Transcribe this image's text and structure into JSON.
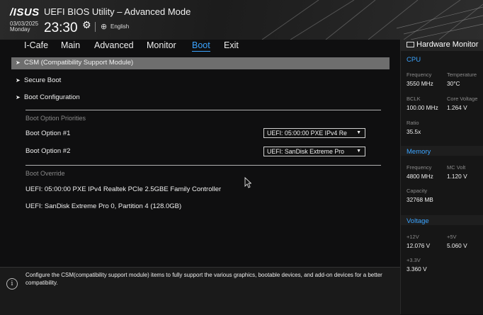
{
  "header": {
    "logo": "/ISUS",
    "title": "UEFI BIOS Utility – Advanced Mode",
    "date": "03/03/2025",
    "day": "Monday",
    "time": "23:30",
    "language": "English"
  },
  "nav": {
    "tabs": [
      {
        "label": "I-Cafe"
      },
      {
        "label": "Main"
      },
      {
        "label": "Advanced"
      },
      {
        "label": "Monitor"
      },
      {
        "label": "Boot"
      },
      {
        "label": "Exit"
      }
    ],
    "active": "Boot"
  },
  "menu": {
    "csm": "CSM (Compatibility Support Module)",
    "secure_boot": "Secure Boot",
    "boot_config": "Boot Configuration",
    "priorities_label": "Boot Option Priorities",
    "option1_label": "Boot Option #1",
    "option1_value": "UEFI: 05:00:00 PXE IPv4 Re",
    "option2_label": "Boot Option #2",
    "option2_value": "UEFI: SanDisk Extreme Pro",
    "override_label": "Boot Override",
    "override1": "UEFI: 05:00:00 PXE IPv4 Realtek PCIe 2.5GBE Family Controller",
    "override2": "UEFI: SanDisk Extreme Pro 0, Partition 4 (128.0GB)"
  },
  "help": {
    "text": "Configure the CSM(compatibility support module) items to fully support the various graphics, bootable devices, and add-on devices for a better compatibility."
  },
  "hw": {
    "title": "Hardware Monitor",
    "cpu": {
      "title": "CPU",
      "freq_label": "Frequency",
      "freq": "3550 MHz",
      "temp_label": "Temperature",
      "temp": "30°C",
      "bclk_label": "BCLK",
      "bclk": "100.00 MHz",
      "cv_label": "Core Voltage",
      "cv": "1.264 V",
      "ratio_label": "Ratio",
      "ratio": "35.5x"
    },
    "memory": {
      "title": "Memory",
      "freq_label": "Frequency",
      "freq": "4800 MHz",
      "mcv_label": "MC Volt",
      "mcv": "1.120 V",
      "cap_label": "Capacity",
      "cap": "32768 MB"
    },
    "voltage": {
      "title": "Voltage",
      "v12_label": "+12V",
      "v12": "12.076 V",
      "v5_label": "+5V",
      "v5": "5.060 V",
      "v33_label": "+3.3V",
      "v33": "3.360 V"
    }
  },
  "colors": {
    "accent": "#3ba4ff",
    "highlight": "#6e6e6e"
  }
}
